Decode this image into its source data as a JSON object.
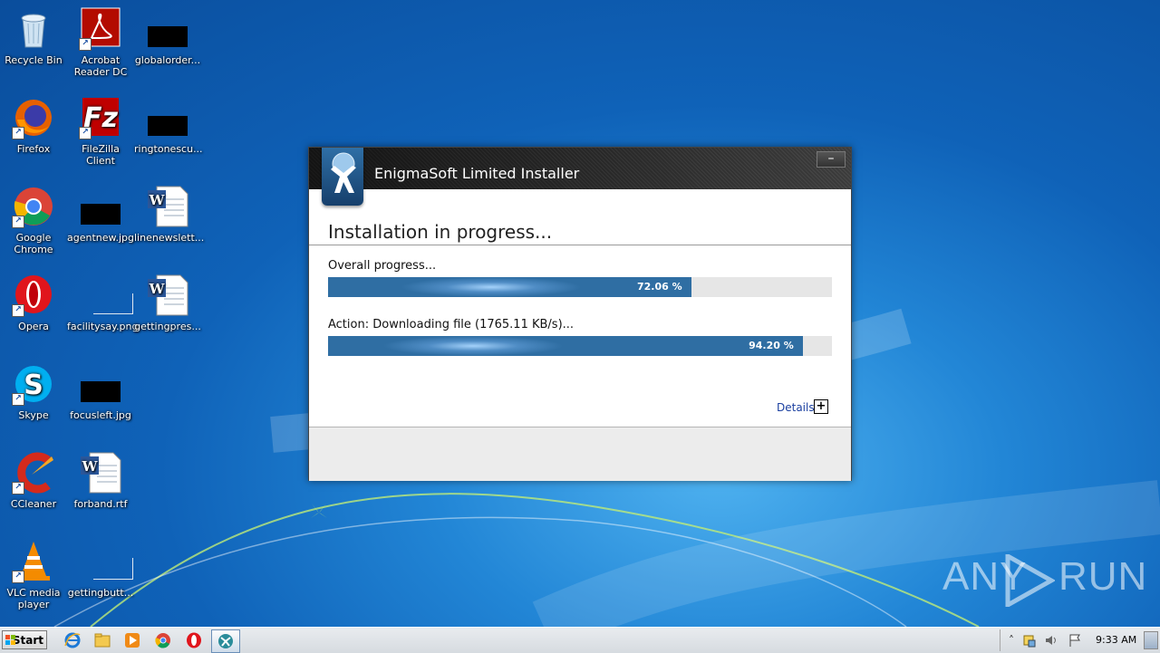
{
  "desktop": {
    "icons": [
      {
        "label": "Recycle Bin",
        "icon": "recycle-bin-icon"
      },
      {
        "label": "Acrobat Reader DC",
        "icon": "acrobat-icon"
      },
      {
        "label": "globalorder...",
        "icon": "black-thumbnail"
      },
      {
        "label": "Firefox",
        "icon": "firefox-icon"
      },
      {
        "label": "FileZilla Client",
        "icon": "filezilla-icon"
      },
      {
        "label": "ringtonescu...",
        "icon": "black-thumbnail"
      },
      {
        "label": "Google Chrome",
        "icon": "chrome-icon"
      },
      {
        "label": "agentnew.jpg",
        "icon": "black-thumbnail"
      },
      {
        "label": "linenewslett...",
        "icon": "word-doc-icon"
      },
      {
        "label": "Opera",
        "icon": "opera-icon"
      },
      {
        "label": "facilitysay.png",
        "icon": "image-thumbnail"
      },
      {
        "label": "gettingpres...",
        "icon": "word-doc-icon"
      },
      {
        "label": "Skype",
        "icon": "skype-icon"
      },
      {
        "label": "focusleft.jpg",
        "icon": "black-thumbnail"
      },
      {
        "label": "CCleaner",
        "icon": "ccleaner-icon"
      },
      {
        "label": "forband.rtf",
        "icon": "word-doc-icon"
      },
      {
        "label": "VLC media player",
        "icon": "vlc-icon"
      },
      {
        "label": "gettingbutt...",
        "icon": "image-thumbnail"
      }
    ]
  },
  "installer": {
    "title": "EnigmaSoft Limited Installer",
    "minimize_label": "–",
    "heading": "Installation in progress...",
    "overall_label": "Overall progress...",
    "overall_percent_text": "72.06 %",
    "overall_progress": 0.7206,
    "action_label": "Action: Downloading file (1765.11 KB/s)...",
    "action_percent_text": "94.20 %",
    "action_progress": 0.942,
    "details_label": "Details",
    "details_toggle": "+"
  },
  "taskbar": {
    "start_label": "Start",
    "pinned": [
      "internet-explorer-icon",
      "file-explorer-icon",
      "media-player-icon",
      "chrome-icon",
      "opera-icon",
      "enigmasoft-installer-icon"
    ],
    "clock": "9:33 AM"
  },
  "watermark": {
    "left": "ANY",
    "right": "RUN"
  },
  "colors": {
    "progress_fill": "#2f6ea3",
    "progress_track": "#e6e6e6",
    "title_bar": "#2c2c2c"
  }
}
